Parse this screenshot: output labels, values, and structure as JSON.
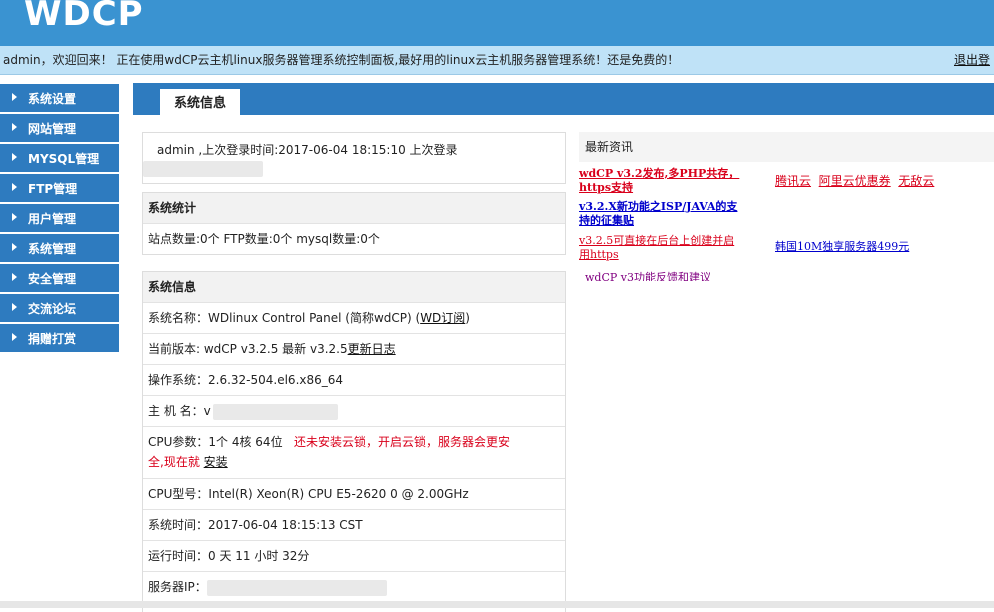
{
  "header": {
    "logo": "WDCP"
  },
  "welcome": {
    "message": "admin，欢迎回来！ 正在使用wdCP云主机linux服务器管理系统控制面板,最好用的linux云主机服务器管理系统！还是免费的！",
    "logout": "退出登"
  },
  "sidebar": {
    "items": [
      {
        "label": "系统设置"
      },
      {
        "label": "网站管理"
      },
      {
        "label": "MYSQL管理"
      },
      {
        "label": "FTP管理"
      },
      {
        "label": "用户管理"
      },
      {
        "label": "系统管理"
      },
      {
        "label": "安全管理"
      },
      {
        "label": "交流论坛"
      },
      {
        "label": "捐赠打赏"
      }
    ]
  },
  "tab": {
    "label": "系统信息"
  },
  "login": {
    "text": "admin ,上次登录时间:2017-06-04 18:15:10 上次登录"
  },
  "stats": {
    "heading": "系统统计",
    "text": "站点数量:0个  FTP数量:0个  mysql数量:0个"
  },
  "sysinfo": {
    "heading": "系统信息",
    "name_label": "系统名称：WDlinux Control Panel (简称wdCP) (",
    "name_link": "WD订阅",
    "name_close": ")",
    "version_label": "当前版本: wdCP v3.2.5 最新 v3.2.5",
    "version_link": "更新日志",
    "os": "操作系统：2.6.32-504.el6.x86_64",
    "hostname_label": "主 机 名：v",
    "cpu_label": "CPU参数：1个 4核 64位",
    "cpu_warn": "还未安装云锁，开启云锁，服务器会更安",
    "cpu_warn2": "全,现在就",
    "cpu_install": "安装",
    "cpu_model": "CPU型号：Intel(R) Xeon(R) CPU E5-2620 0 @ 2.00GHz",
    "time": "系统时间：2017-06-04 18:15:13 CST",
    "uptime": "运行时间：0 天 11 小时 32分",
    "ip_label": "服务器IP："
  },
  "news": {
    "title": "最新资讯",
    "items": [
      {
        "line1": "wdCP v3.2发布,多PHP共存，",
        "line2": "https支持",
        "color": "#d9001b"
      },
      {
        "line1": "v3.2.X新功能之ISP/JAVA的支",
        "line2": "持的征集贴",
        "color": "#0000cc"
      },
      {
        "line1": "v3.2.5可直接在后台上创建并启",
        "line2": "用https",
        "color": "#d9001b"
      },
      {
        "line1": "wdCP v3功能反馈和建议",
        "color": "#800080"
      }
    ],
    "ads": [
      "腾讯云",
      "阿里云优惠券",
      "无敌云"
    ],
    "ad2": "韩国10M独享服务器499元"
  }
}
